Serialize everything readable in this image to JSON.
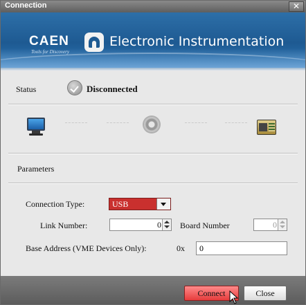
{
  "window": {
    "title": "Connection",
    "close_symbol": "✕"
  },
  "banner": {
    "brand": "CAEN",
    "tagline": "Tools for Discovery",
    "product_text": "Electronic Instrumentation"
  },
  "status": {
    "label": "Status",
    "value": "Disconnected",
    "icon": "check-circle-icon"
  },
  "diagram": {
    "icons": [
      "monitor-icon",
      "gear-icon",
      "board-icon"
    ]
  },
  "parameters": {
    "section_label": "Parameters",
    "connection_type": {
      "label": "Connection Type:",
      "value": "USB"
    },
    "link_number": {
      "label": "Link Number:",
      "value": "0"
    },
    "board_number": {
      "label": "Board Number",
      "value": "0"
    },
    "base_address": {
      "label": "Base Address (VME Devices Only):",
      "prefix": "0x",
      "value": "0"
    }
  },
  "footer": {
    "connect_label": "Connect",
    "close_label": "Close"
  },
  "colors": {
    "accent": "#c9302e",
    "banner": "#1e5a92",
    "footer": "#6a6a6a"
  }
}
